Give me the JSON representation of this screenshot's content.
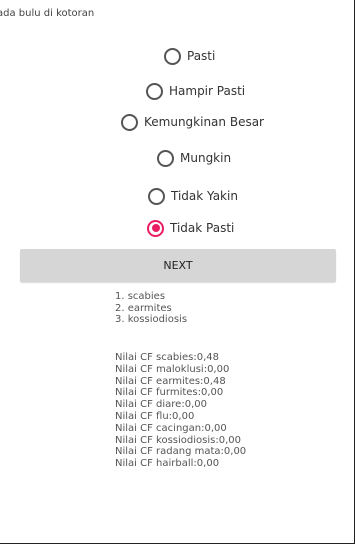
{
  "question": "ada bulu di kotoran",
  "options": [
    {
      "label": "Pasti",
      "checked": false
    },
    {
      "label": "Hampir Pasti",
      "checked": false
    },
    {
      "label": "Kemungkinan Besar",
      "checked": false
    },
    {
      "label": "Mungkin",
      "checked": false
    },
    {
      "label": "Tidak Yakin",
      "checked": false
    },
    {
      "label": "Tidak Pasti",
      "checked": true
    }
  ],
  "next_label": "NEXT",
  "results": [
    "1. scabies",
    "2. earmites",
    "3. kossiodiosis"
  ],
  "scores": [
    "Nilai CF scabies:0,48",
    "Nilai CF maloklusi:0,00",
    "Nilai CF earmites:0,48",
    "Nilai CF furmites:0,00",
    "Nilai CF diare:0,00",
    "Nilai CF flu:0,00",
    "Nilai CF cacingan:0,00",
    "Nilai CF kossiodiosis:0,00",
    "Nilai CF radang mata:0,00",
    "Nilai CF hairball:0,00"
  ],
  "colors": {
    "accent": "#e91e63",
    "button_bg": "#d6d6d6"
  }
}
